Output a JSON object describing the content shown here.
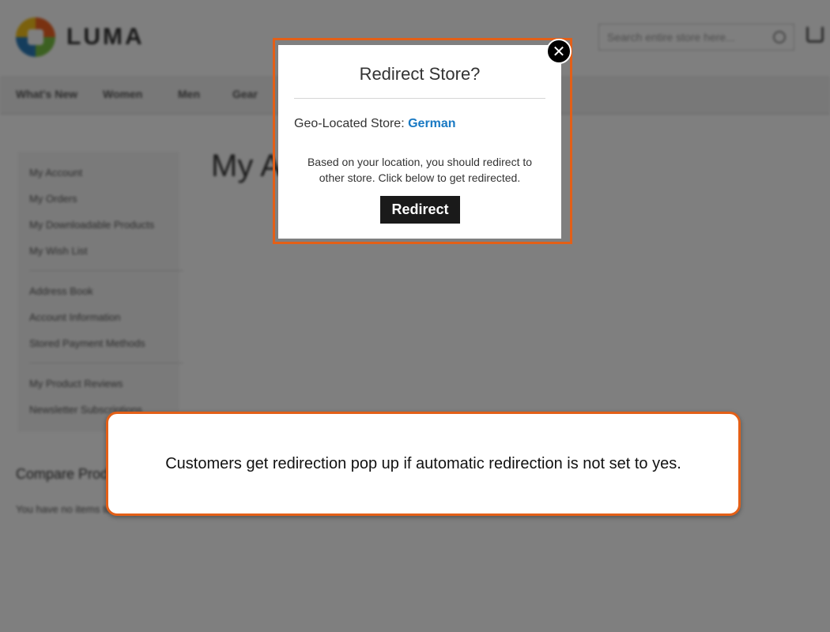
{
  "header": {
    "logo_text": "LUMA",
    "search_placeholder": "Search entire store here..."
  },
  "nav": {
    "items": [
      "What's New",
      "Women",
      "Men",
      "Gear"
    ]
  },
  "sidebar": {
    "items": [
      "My Account",
      "My Orders",
      "My Downloadable Products",
      "My Wish List",
      "Address Book",
      "Account Information",
      "Stored Payment Methods",
      "My Product Reviews",
      "Newsletter Subscriptions"
    ]
  },
  "main": {
    "page_title": "My A",
    "compare_title": "Compare Products",
    "compare_text": "You have no items to compare."
  },
  "modal": {
    "title": "Redirect Store?",
    "geo_label": "Geo-Located Store:",
    "geo_store": "German",
    "message": "Based on your location, you should redirect to other store. Click below to get redirected.",
    "redirect_label": "Redirect",
    "close_glyph": "✕"
  },
  "callout": {
    "text": "Customers get redirection pop up if automatic redirection is not set to yes."
  },
  "colors": {
    "highlight": "#e35f17",
    "link": "#1979c3",
    "button": "#1a1a1a"
  }
}
